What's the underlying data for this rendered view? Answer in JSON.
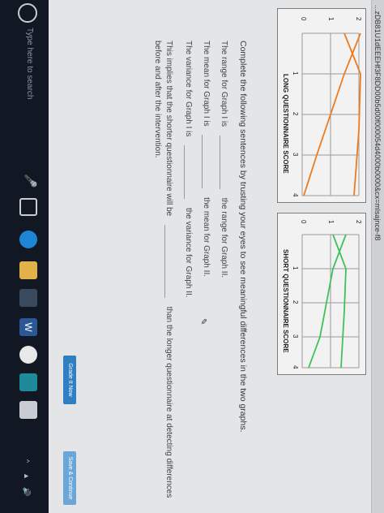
{
  "browser": {
    "url_fragment": "...zDB81U1dEEEHf3F8DD00b5d00f000054d4000b0000&cx=mlsajnce-f8"
  },
  "graphs": {
    "long": {
      "title": "LONG QUESTIONNAIRE SCORE",
      "y_ticks": [
        "2",
        "1",
        "0"
      ],
      "x_ticks": [
        "1",
        "2",
        "3",
        "4"
      ]
    },
    "short": {
      "title": "SHORT QUESTIONNAIRE SCORE",
      "y_ticks": [
        "2",
        "1",
        "0"
      ],
      "x_ticks": [
        "1",
        "2",
        "3",
        "4"
      ]
    }
  },
  "instructions": "Complete the following sentences by trusting your eyes to see meaningful differences in the two graphs.",
  "sentences": {
    "range_a": "The range for Graph I is",
    "range_b": "the range for Graph II.",
    "mean_a": "The mean for Graph I is",
    "mean_b": "the mean for Graph II.",
    "variance_a": "The variance for Graph I is",
    "variance_b": "the variance for Graph II.",
    "implies_a": "This implies that the shorter questionnaire will be",
    "implies_b": "than the longer questionnaire at detecting differences",
    "implies_c": "before and after the intervention."
  },
  "buttons": {
    "grade": "Grade It Now",
    "save": "Save & Continue"
  },
  "taskbar": {
    "search_placeholder": "Type here to search"
  },
  "colors": {
    "orange_line": "#f07a1a",
    "green_line": "#3fc15a",
    "button_blue": "#2f7fc2",
    "taskbar": "#111823"
  }
}
